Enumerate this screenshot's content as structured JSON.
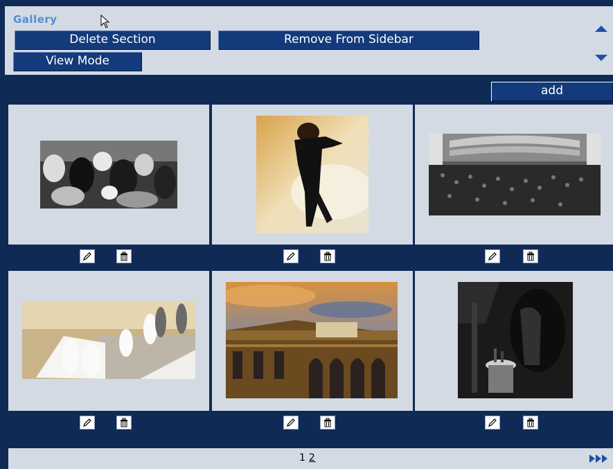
{
  "header": {
    "title": "Gallery",
    "delete_label": "Delete Section",
    "remove_label": "Remove From Sidebar",
    "view_mode_label": "View Mode"
  },
  "toolbar": {
    "add_label": "add"
  },
  "gallery": {
    "items": [
      {
        "icon": "photo-ballroom-dancers"
      },
      {
        "icon": "photo-dancer-in-tailcoat"
      },
      {
        "icon": "photo-opera-auditorium"
      },
      {
        "icon": "photo-debutantes-staircase"
      },
      {
        "icon": "photo-opera-house-exterior"
      },
      {
        "icon": "photo-man-at-table"
      }
    ],
    "item_actions": {
      "edit": "pencil-icon",
      "delete": "trash-icon"
    }
  },
  "pager": {
    "page1": "1",
    "page2": "2"
  },
  "colors": {
    "accent": "#0f2a55",
    "panel": "#d3dae3",
    "button": "#133a7a",
    "title": "#4f8fd6"
  }
}
